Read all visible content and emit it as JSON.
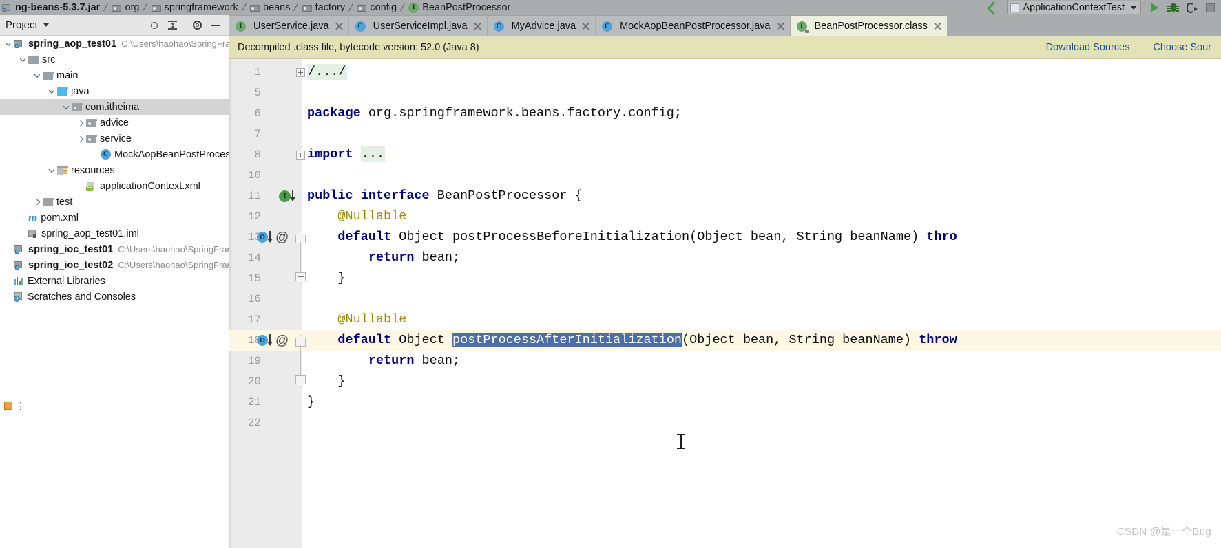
{
  "breadcrumb": {
    "items": [
      {
        "label": "ng-beans-5.3.7.jar",
        "icon": "jar-icon",
        "bold": true
      },
      {
        "label": "org",
        "icon": "package-icon",
        "bold": false
      },
      {
        "label": "springframework",
        "icon": "package-icon",
        "bold": false
      },
      {
        "label": "beans",
        "icon": "package-icon",
        "bold": false
      },
      {
        "label": "factory",
        "icon": "package-icon",
        "bold": false
      },
      {
        "label": "config",
        "icon": "package-icon",
        "bold": false
      },
      {
        "label": "BeanPostProcessor",
        "icon": "interface-icon",
        "bold": false
      }
    ],
    "separator": "⟩"
  },
  "toolbar": {
    "back_icon": "back-arrow-icon",
    "run_configuration": "ApplicationContextTest",
    "run_config_icon": "run-configuration-icon",
    "dropdown_icon": "chevron-down-icon",
    "run_icon": "run-icon",
    "debug_icon": "debug-icon",
    "coverage_icon": "run-with-coverage-icon",
    "stop_icon": "stop-icon"
  },
  "project_panel": {
    "title": "Project",
    "actions": [
      {
        "name": "select-opened-file-icon",
        "icon": "target-icon"
      },
      {
        "name": "collapse-all-icon",
        "icon": "collapse-all-icon"
      },
      {
        "name": "settings-icon",
        "icon": "gear-icon"
      },
      {
        "name": "hide-icon",
        "icon": "minus-icon"
      }
    ],
    "tree": [
      {
        "label": "spring_aop_test01",
        "path": "C:\\Users\\haohao\\SpringFrame",
        "indent": 0,
        "twisty": "open",
        "icon": "project-module-icon",
        "bold": true,
        "selected": false
      },
      {
        "label": "src",
        "path": "",
        "indent": 1,
        "twisty": "open",
        "icon": "folder-icon",
        "bold": false,
        "selected": false
      },
      {
        "label": "main",
        "path": "",
        "indent": 2,
        "twisty": "open",
        "icon": "folder-icon",
        "bold": false,
        "selected": false
      },
      {
        "label": "java",
        "path": "",
        "indent": 3,
        "twisty": "open",
        "icon": "source-folder-icon",
        "bold": false,
        "selected": false
      },
      {
        "label": "com.itheima",
        "path": "",
        "indent": 4,
        "twisty": "open",
        "icon": "package-folder-icon",
        "bold": false,
        "selected": true
      },
      {
        "label": "advice",
        "path": "",
        "indent": 5,
        "twisty": "closed",
        "icon": "package-folder-icon",
        "bold": false,
        "selected": false
      },
      {
        "label": "service",
        "path": "",
        "indent": 5,
        "twisty": "closed",
        "icon": "package-folder-icon",
        "bold": false,
        "selected": false
      },
      {
        "label": "MockAopBeanPostProcessor",
        "path": "",
        "indent": 6,
        "twisty": "none",
        "icon": "class-icon",
        "bold": false,
        "selected": false
      },
      {
        "label": "resources",
        "path": "",
        "indent": 3,
        "twisty": "open",
        "icon": "resources-folder-icon",
        "bold": false,
        "selected": false
      },
      {
        "label": "applicationContext.xml",
        "path": "",
        "indent": 5,
        "twisty": "none",
        "icon": "xml-file-icon",
        "bold": false,
        "selected": false
      },
      {
        "label": "test",
        "path": "",
        "indent": 2,
        "twisty": "closed",
        "icon": "folder-icon",
        "bold": false,
        "selected": false
      },
      {
        "label": "pom.xml",
        "path": "",
        "indent": 1,
        "twisty": "none",
        "icon": "maven-file-icon",
        "bold": false,
        "selected": false
      },
      {
        "label": "spring_aop_test01.iml",
        "path": "",
        "indent": 1,
        "twisty": "none",
        "icon": "iml-file-icon",
        "bold": false,
        "selected": false
      },
      {
        "label": "spring_ioc_test01",
        "path": "C:\\Users\\haohao\\SpringFramev",
        "indent": 0,
        "twisty": "none",
        "icon": "project-module-icon",
        "bold": true,
        "selected": false
      },
      {
        "label": "spring_ioc_test02",
        "path": "C:\\Users\\haohao\\SpringFramev",
        "indent": 0,
        "twisty": "none",
        "icon": "project-module-icon",
        "bold": true,
        "selected": false
      },
      {
        "label": "External Libraries",
        "path": "",
        "indent": 0,
        "twisty": "none",
        "icon": "external-libraries-icon",
        "bold": false,
        "selected": false
      },
      {
        "label": "Scratches and Consoles",
        "path": "",
        "indent": 0,
        "twisty": "none",
        "icon": "scratches-icon",
        "bold": false,
        "selected": false
      }
    ]
  },
  "editor_tabs": [
    {
      "label": "UserService.java",
      "icon": "interface-icon",
      "active": false,
      "locked": false
    },
    {
      "label": "UserServiceImpl.java",
      "icon": "class-icon",
      "active": false,
      "locked": false
    },
    {
      "label": "MyAdvice.java",
      "icon": "class-icon",
      "active": false,
      "locked": false
    },
    {
      "label": "MockAopBeanPostProcessor.java",
      "icon": "class-icon",
      "active": false,
      "locked": false
    },
    {
      "label": "BeanPostProcessor.class",
      "icon": "interface-icon",
      "active": true,
      "locked": true
    }
  ],
  "notification": {
    "text": "Decompiled .class file, bytecode version: 52.0 (Java 8)",
    "links": [
      "Download Sources",
      "Choose Sour"
    ]
  },
  "code": {
    "lines": [
      {
        "num": "1",
        "indent": 0,
        "segments": [
          {
            "t": "/.../",
            "c": "fold"
          }
        ]
      },
      {
        "num": "5",
        "indent": 0,
        "segments": []
      },
      {
        "num": "6",
        "indent": 0,
        "segments": [
          {
            "t": "package",
            "c": "kw"
          },
          {
            "t": " org.springframework.beans.factory.config;",
            "c": ""
          }
        ]
      },
      {
        "num": "7",
        "indent": 0,
        "segments": []
      },
      {
        "num": "8",
        "indent": 0,
        "segments": [
          {
            "t": "import",
            "c": "kw"
          },
          {
            "t": " ",
            "c": ""
          },
          {
            "t": "...",
            "c": "fold"
          }
        ]
      },
      {
        "num": "10",
        "indent": 0,
        "segments": []
      },
      {
        "num": "11",
        "indent": 0,
        "segments": [
          {
            "t": "public interface",
            "c": "kw"
          },
          {
            "t": " BeanPostProcessor {",
            "c": ""
          }
        ]
      },
      {
        "num": "12",
        "indent": 0,
        "segments": [
          {
            "t": "    @Nullable",
            "c": "ann"
          }
        ]
      },
      {
        "num": "13",
        "indent": 0,
        "segments": [
          {
            "t": "    ",
            "c": ""
          },
          {
            "t": "default",
            "c": "kw"
          },
          {
            "t": " Object postProcessBeforeInitialization(Object bean, String beanName) ",
            "c": ""
          },
          {
            "t": "thro",
            "c": "kw"
          }
        ]
      },
      {
        "num": "14",
        "indent": 0,
        "segments": [
          {
            "t": "        ",
            "c": ""
          },
          {
            "t": "return",
            "c": "kw"
          },
          {
            "t": " bean;",
            "c": ""
          }
        ]
      },
      {
        "num": "15",
        "indent": 0,
        "segments": [
          {
            "t": "    }",
            "c": ""
          }
        ]
      },
      {
        "num": "16",
        "indent": 0,
        "segments": []
      },
      {
        "num": "17",
        "indent": 0,
        "segments": [
          {
            "t": "    @Nullable",
            "c": "ann"
          }
        ]
      },
      {
        "num": "18",
        "indent": 0,
        "segments": [
          {
            "t": "    ",
            "c": ""
          },
          {
            "t": "default",
            "c": "kw"
          },
          {
            "t": " Object ",
            "c": ""
          },
          {
            "t": "postProcessAfterInitialization",
            "c": "sel-token"
          },
          {
            "t": "(Object bean, String beanName) ",
            "c": ""
          },
          {
            "t": "throw",
            "c": "kw"
          }
        ]
      },
      {
        "num": "19",
        "indent": 0,
        "segments": [
          {
            "t": "        ",
            "c": ""
          },
          {
            "t": "return",
            "c": "kw"
          },
          {
            "t": " bean;",
            "c": ""
          }
        ]
      },
      {
        "num": "20",
        "indent": 0,
        "segments": [
          {
            "t": "    }",
            "c": ""
          }
        ]
      },
      {
        "num": "21",
        "indent": 0,
        "segments": [
          {
            "t": "}",
            "c": ""
          }
        ]
      },
      {
        "num": "22",
        "indent": 0,
        "segments": []
      }
    ],
    "caret_line_index": 13,
    "selection_text": "postProcessAfterInitialization",
    "selection_color": "#4c6ea5",
    "gutter_marks": [
      {
        "line_index": 6,
        "type": "implemented-interface-marker",
        "letter": "I",
        "arrow": true,
        "at": false
      },
      {
        "line_index": 8,
        "type": "overriding-method-marker",
        "letter": "O",
        "arrow": true,
        "at": true
      },
      {
        "line_index": 13,
        "type": "overriding-method-marker",
        "letter": "O",
        "arrow": true,
        "at": true
      }
    ]
  },
  "watermark": "CSDN @是一个Bug"
}
